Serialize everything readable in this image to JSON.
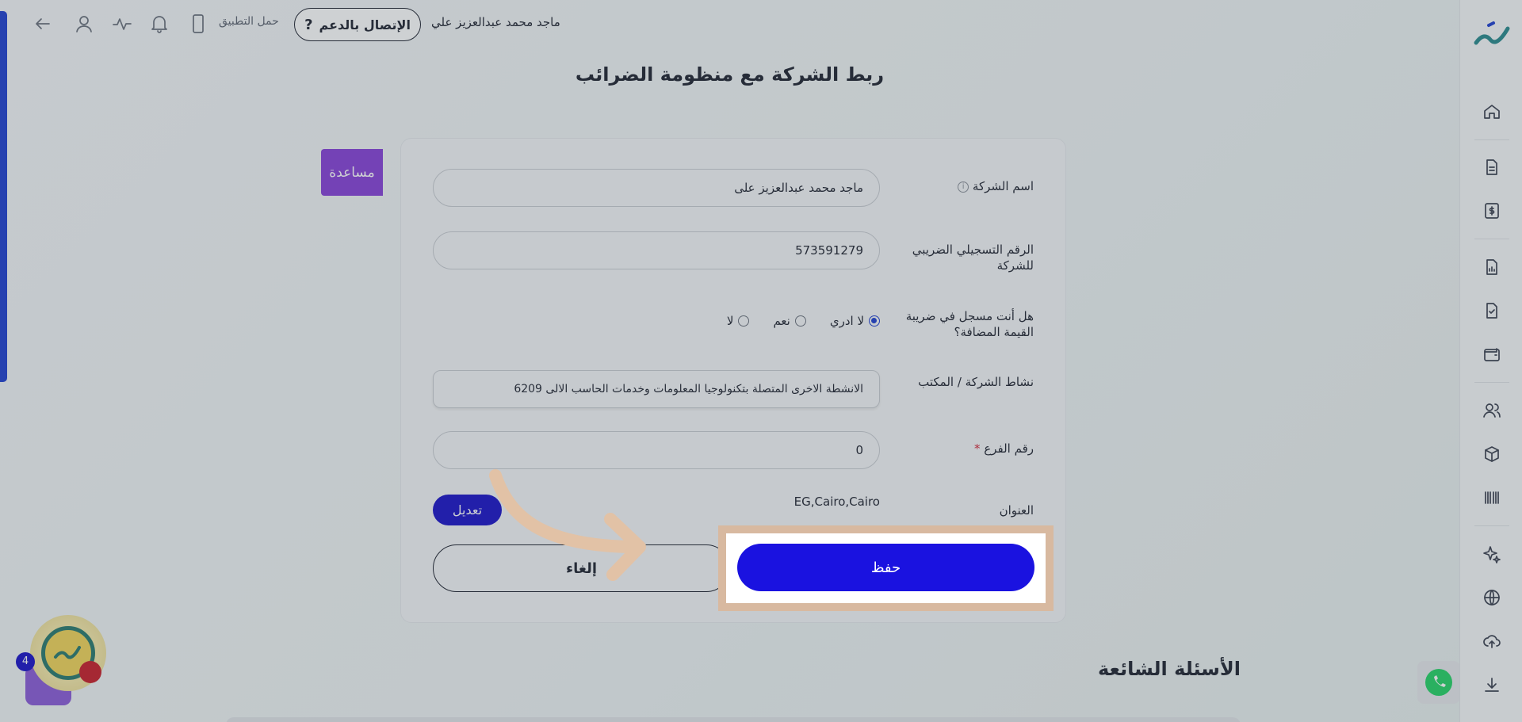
{
  "topbar": {
    "user_name": "ماجد محمد عبدالعزيز علي",
    "support_label": "الإتصال بالدعم",
    "support_icon": "?",
    "download_app": "حمل التطبيق"
  },
  "page_title": "ربط الشركة مع منظومة الضرائب",
  "help_label": "مساعدة",
  "form": {
    "company_name_label": "اسم الشركة",
    "company_name_value": "ماجد محمد عبدالعزيز على",
    "tax_id_label": "الرقم التسجيلي الضريبي للشركة",
    "tax_id_value": "573591279",
    "vat_question_label": "هل أنت مسجل في ضريبة القيمة المضافة؟",
    "vat_options": [
      "لا ادري",
      "نعم",
      "لا"
    ],
    "vat_selected_index": 0,
    "activity_label": "نشاط الشركة / المكتب",
    "activity_value": "الانشطة الاخرى المتصلة بتكنولوجيا المعلومات وخدمات الحاسب الالى 6209",
    "branch_label": "رقم الفرع",
    "branch_required": "*",
    "branch_value": "0",
    "address_label": "العنوان",
    "address_value": "EG,Cairo,Cairo",
    "edit_label": "تعديل",
    "cancel_label": "إلغاء",
    "save_label": "حفظ"
  },
  "faq_title": "الأسئلة الشائعة",
  "notification_badge": "4",
  "colors": {
    "primary": "#1a12e0",
    "help": "#8741d8",
    "highlight": "#d8b9a0"
  }
}
